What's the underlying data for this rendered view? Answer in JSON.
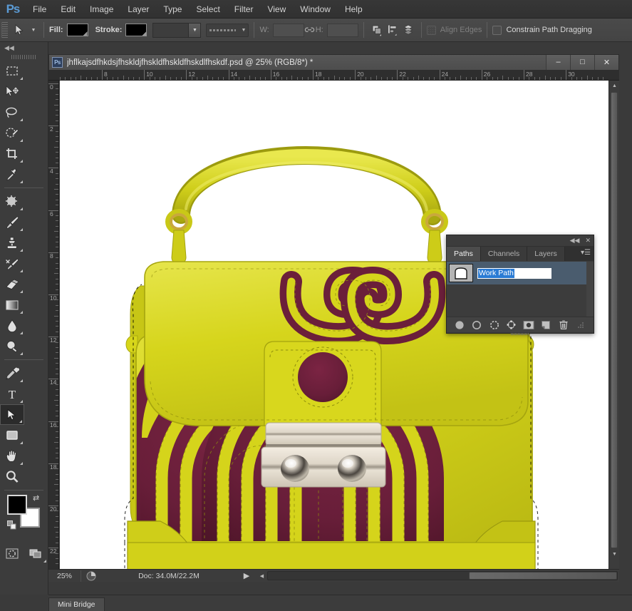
{
  "app": {
    "logo": "Ps"
  },
  "menubar": {
    "items": [
      "File",
      "Edit",
      "Image",
      "Layer",
      "Type",
      "Select",
      "Filter",
      "View",
      "Window",
      "Help"
    ]
  },
  "options": {
    "fill_label": "Fill:",
    "stroke_label": "Stroke:",
    "fill_color": "#000000",
    "stroke_color": "#000000",
    "width_label": "W:",
    "height_label": "H:",
    "width_value": "",
    "height_value": "",
    "align_edges_label": "Align Edges",
    "constrain_label": "Constrain Path Dragging",
    "align_edges_checked": false,
    "constrain_checked": false
  },
  "toolbar": {
    "tools": [
      {
        "name": "rectangular-marquee-tool",
        "active": false
      },
      {
        "name": "move-tool",
        "active": false
      },
      {
        "name": "lasso-tool",
        "active": false
      },
      {
        "name": "quick-selection-tool",
        "active": false
      },
      {
        "name": "crop-tool",
        "active": false
      },
      {
        "name": "eyedropper-tool",
        "active": false
      },
      {
        "name": "spot-healing-brush-tool",
        "active": false
      },
      {
        "name": "brush-tool",
        "active": false
      },
      {
        "name": "clone-stamp-tool",
        "active": false
      },
      {
        "name": "history-brush-tool",
        "active": false
      },
      {
        "name": "eraser-tool",
        "active": false
      },
      {
        "name": "gradient-tool",
        "active": false
      },
      {
        "name": "blur-tool",
        "active": false
      },
      {
        "name": "dodge-tool",
        "active": false
      },
      {
        "name": "pen-tool",
        "active": false
      },
      {
        "name": "horizontal-type-tool",
        "active": false
      },
      {
        "name": "path-selection-tool",
        "active": true
      },
      {
        "name": "rectangle-tool",
        "active": false
      },
      {
        "name": "hand-tool",
        "active": false
      },
      {
        "name": "zoom-tool",
        "active": false
      }
    ],
    "foreground_color": "#000000",
    "background_color": "#ffffff"
  },
  "document": {
    "title": "jhflkajsdfhkdsjfhskldjfhskldfhskldfhskdlfhskdf.psd @ 25% (RGB/8*) *",
    "badge": "Ps",
    "minimize": "–",
    "maximize": "□",
    "close": "✕",
    "ruler_h_labels": [
      "8",
      "10",
      "12",
      "14",
      "16",
      "18",
      "20",
      "22",
      "24",
      "26",
      "28",
      "30"
    ],
    "ruler_v_labels": [
      "0",
      "2",
      "4",
      "6",
      "8",
      "10",
      "12",
      "14",
      "16",
      "18",
      "20",
      "22"
    ],
    "ruler_unit": "inches"
  },
  "statusbar": {
    "zoom": "25%",
    "doc_info": "Doc: 34.0M/22.2M",
    "arrow": "▶"
  },
  "paths_panel": {
    "tabs": [
      {
        "label": "Layers",
        "active": false
      },
      {
        "label": "Channels",
        "active": false
      },
      {
        "label": "Paths",
        "active": true
      }
    ],
    "collapse_icon": "◀◀",
    "close_icon": "✕",
    "menu_icon": "▾☰",
    "path_name": "Work Path",
    "path_name_selected": true,
    "footer_buttons": [
      {
        "name": "fill-path-button"
      },
      {
        "name": "stroke-path-button"
      },
      {
        "name": "load-path-as-selection-button"
      },
      {
        "name": "make-work-path-from-selection-button"
      },
      {
        "name": "add-layer-mask-button"
      },
      {
        "name": "create-new-path-button"
      },
      {
        "name": "delete-path-button"
      }
    ]
  },
  "bottombar": {
    "mini_bridge_label": "Mini Bridge"
  },
  "colors": {
    "bag_yellow": "#d5d418",
    "bag_yellow_dark": "#b5b414",
    "bag_yellow_light": "#e3e24a",
    "bag_burgundy": "#6b1f3a",
    "bag_burgundy_dark": "#4f1529",
    "hardware_silver": "#e8e0d4",
    "panel_accent": "#2a7bd4",
    "canvas_bg": "#ffffff"
  }
}
